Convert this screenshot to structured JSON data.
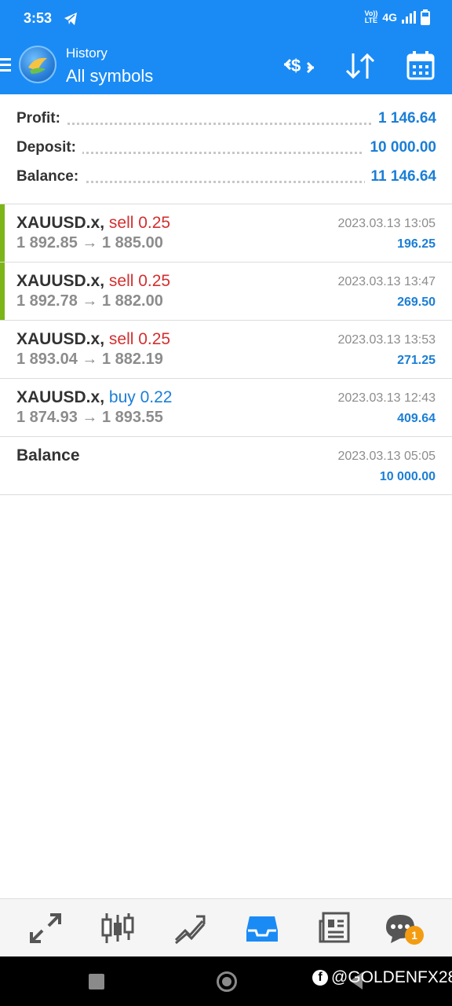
{
  "status": {
    "time": "3:53",
    "volte_top": "Vo))",
    "volte_bottom": "LTE",
    "network": "4G"
  },
  "header": {
    "subtitle": "History",
    "title": "All symbols",
    "icons": [
      "menu-icon",
      "mt-logo-icon",
      "currency-exchange-icon",
      "sort-icon",
      "calendar-icon"
    ]
  },
  "summary": {
    "profit_label": "Profit:",
    "profit_value": "1 146.64",
    "deposit_label": "Deposit:",
    "deposit_value": "10 000.00",
    "balance_label": "Balance:",
    "balance_value": "11 146.64"
  },
  "trades": [
    {
      "symbol": "XAUUSD.x",
      "sep": ",",
      "side": "sell 0.25",
      "prices": "1 892.85 → 1 885.00",
      "time": "2023.03.13 13:05",
      "profit": "196.25"
    },
    {
      "symbol": "XAUUSD.x",
      "sep": ",",
      "side": "sell 0.25",
      "prices": "1 892.78 → 1 882.00",
      "time": "2023.03.13 13:47",
      "profit": "269.50"
    },
    {
      "symbol": "XAUUSD.x",
      "sep": ",",
      "side": "sell 0.25",
      "prices": "1 893.04 → 1 882.19",
      "time": "2023.03.13 13:53",
      "profit": "271.25"
    },
    {
      "symbol": "XAUUSD.x",
      "sep": ",",
      "side": "buy 0.22",
      "prices": "1 874.93 → 1 893.55",
      "time": "2023.03.13 12:43",
      "profit": "409.64"
    }
  ],
  "balance_entry": {
    "label": "Balance",
    "time": "2023.03.13 05:05",
    "amount": "10 000.00"
  },
  "tabs": [
    "quotes-icon",
    "chart-icon",
    "trade-icon",
    "history-icon",
    "news-icon",
    "chat-icon"
  ],
  "chat_badge": "1",
  "watermark": "@GOLDENFX28",
  "colors": {
    "accent": "#1a8bf5",
    "sell": "#d32f2f",
    "buy": "#1a7ed6",
    "marker": "#7cb518",
    "badge": "#f39c12"
  }
}
